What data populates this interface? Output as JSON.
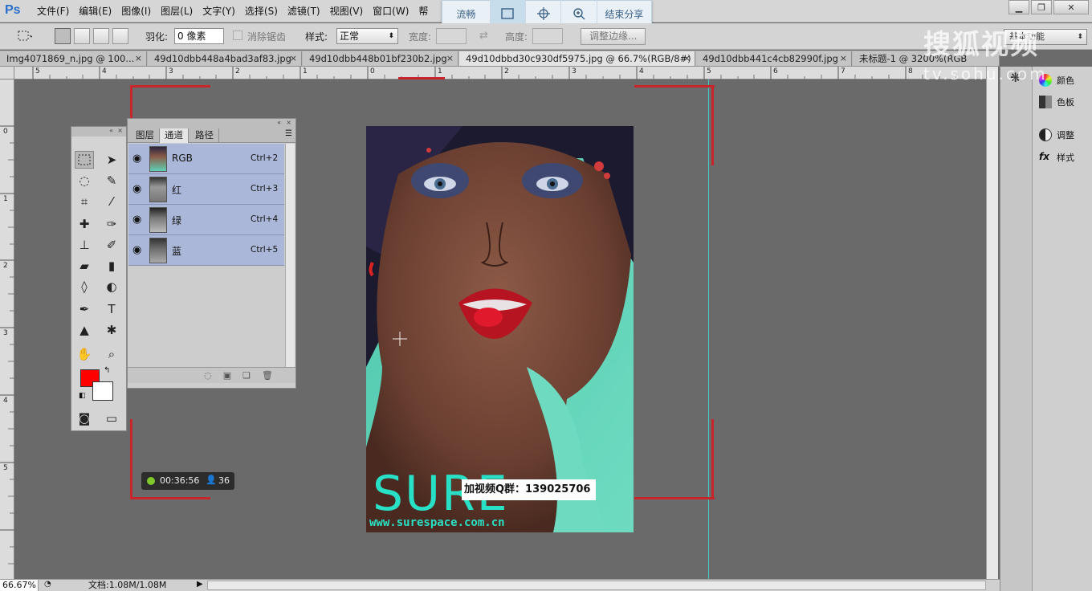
{
  "app": {
    "logo": "Ps"
  },
  "menu": [
    "文件(F)",
    "编辑(E)",
    "图像(I)",
    "图层(L)",
    "文字(Y)",
    "选择(S)",
    "滤镜(T)",
    "视图(V)",
    "窗口(W)",
    "帮"
  ],
  "share_bar": {
    "smooth_label": "流畅",
    "end_share_label": "结束分享"
  },
  "options": {
    "feather_label": "羽化:",
    "feather_value": "0 像素",
    "antialias_label": "消除锯齿",
    "style_label": "样式:",
    "style_value": "正常",
    "width_label": "宽度:",
    "height_label": "高度:",
    "refine_edge_label": "调整边缘..."
  },
  "workspace": "基本功能",
  "tabs": [
    "Img4071869_n.jpg @ 100...",
    "49d10dbb448a4bad3af83.jpg",
    "49d10dbb448b01bf230b2.jpg",
    "49d10dbbd30c930df5975.jpg @ 66.7%(RGB/8#)",
    "49d10dbb441c4cb82990f.jpg",
    "未标题-1 @ 3200%(RGB"
  ],
  "ruler_top": [
    "5",
    "4",
    "3",
    "2",
    "1",
    "0",
    "1",
    "2",
    "3",
    "4",
    "5",
    "6",
    "7",
    "8"
  ],
  "ruler_left": [
    "0",
    "1",
    "2",
    "3",
    "4",
    "5"
  ],
  "channels_panel": {
    "tabs": [
      "图层",
      "通道",
      "路径"
    ],
    "rows": [
      {
        "name": "RGB",
        "shortcut": "Ctrl+2"
      },
      {
        "name": "红",
        "shortcut": "Ctrl+3"
      },
      {
        "name": "绿",
        "shortcut": "Ctrl+4"
      },
      {
        "name": "蓝",
        "shortcut": "Ctrl+5"
      }
    ]
  },
  "right_dock": {
    "color": "颜色",
    "swatches": "色板",
    "adjustments": "调整",
    "styles": "样式"
  },
  "photo": {
    "brand": "SURE",
    "url": "www.surespace.com.cn"
  },
  "overlay": {
    "qq_group": "加视频Q群：139025706",
    "timer": "00:36:56",
    "viewers": "36"
  },
  "watermark": {
    "line1": "搜狐视频",
    "line2": "tv.sohu.com"
  },
  "status": {
    "zoom": "66.67%",
    "doc": "文档:1.08M/1.08M"
  },
  "colors": {
    "foreground": "#ff0000",
    "background": "#ffffff",
    "frame_red": "#c9262c",
    "guide_cyan": "#49c9c9"
  }
}
